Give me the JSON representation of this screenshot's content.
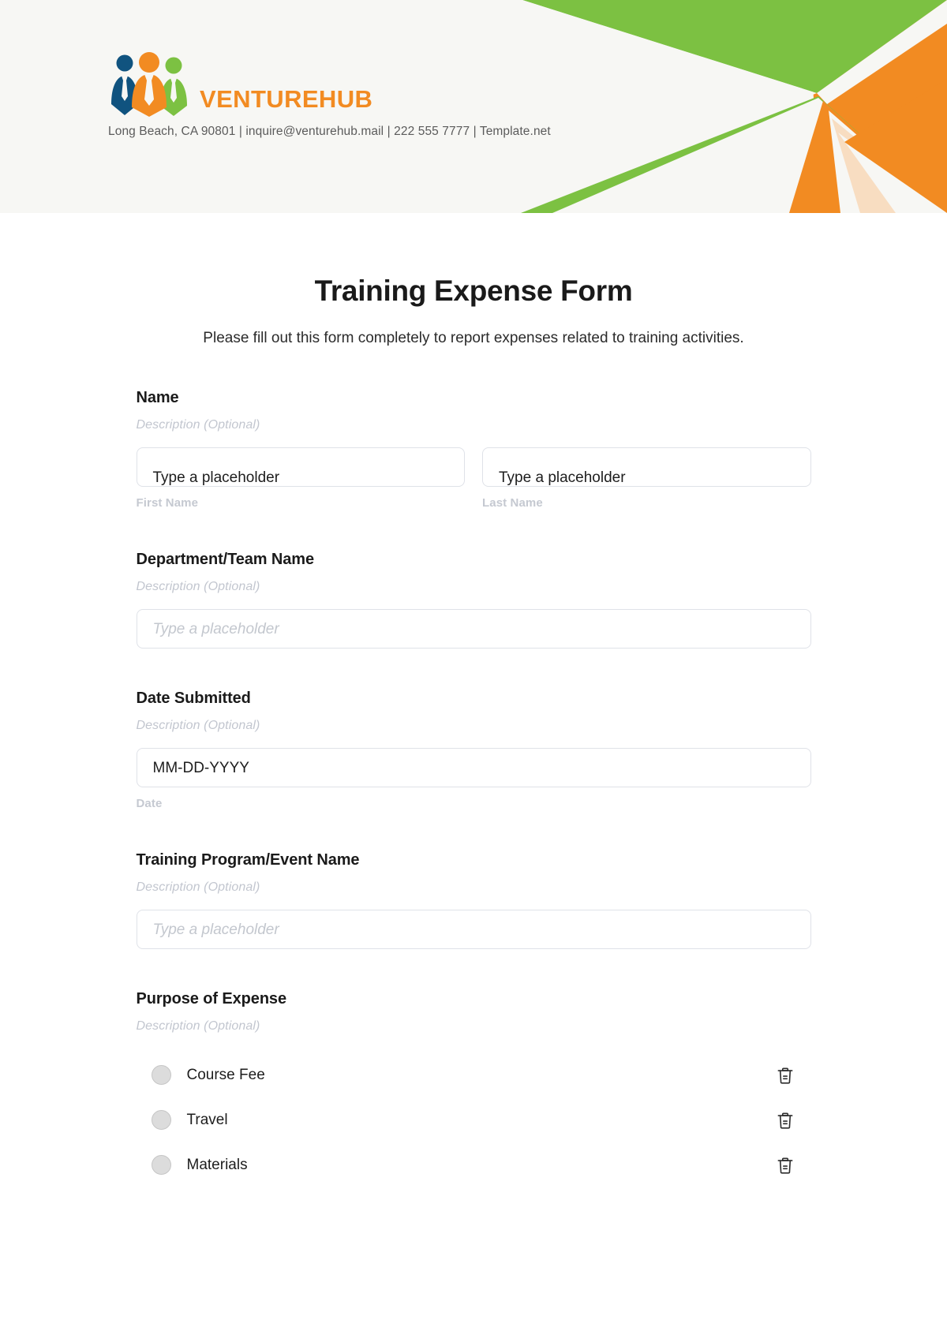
{
  "header": {
    "brand_name": "VENTUREHUB",
    "contact_line": "Long Beach, CA 90801 | inquire@venturehub.mail | 222 555 7777 | Template.net",
    "logo_icon": "three-people-group-icon",
    "colors": {
      "background": "#f7f7f4",
      "brand_orange": "#f28b22",
      "accent_green": "#7cc142",
      "accent_orange": "#f28b22",
      "accent_peach": "#f8ddc1",
      "logo_navy": "#10537f",
      "logo_orange": "#f28b22",
      "logo_green": "#7cc142"
    }
  },
  "form": {
    "title": "Training Expense Form",
    "subtitle": "Please fill out this form completely to report expenses related to training activities.",
    "description_placeholder": "Description (Optional)",
    "sections": [
      {
        "id": "name",
        "label": "Name",
        "description": "Description (Optional)",
        "inputs": [
          {
            "id": "first-name",
            "value": "Type a placeholder",
            "placeholder": "Type a placeholder",
            "sub_label": "First Name",
            "style": "clipped"
          },
          {
            "id": "last-name",
            "value": "Type a placeholder",
            "placeholder": "Type a placeholder",
            "sub_label": "Last Name",
            "style": "clipped"
          }
        ]
      },
      {
        "id": "department-team-name",
        "label": "Department/Team Name",
        "description": "Description (Optional)",
        "inputs": [
          {
            "id": "department",
            "value": "Type a placeholder",
            "placeholder": "Type a placeholder",
            "sub_label": "",
            "style": "placeholder"
          }
        ]
      },
      {
        "id": "date-submitted",
        "label": "Date Submitted",
        "description": "Description (Optional)",
        "inputs": [
          {
            "id": "date",
            "value": "MM-DD-YYYY",
            "placeholder": "MM-DD-YYYY",
            "sub_label": "Date",
            "style": "value"
          }
        ]
      },
      {
        "id": "training-program-event-name",
        "label": "Training Program/Event Name",
        "description": "Description (Optional)",
        "inputs": [
          {
            "id": "training-program",
            "value": "Type a placeholder",
            "placeholder": "Type a placeholder",
            "sub_label": "",
            "style": "placeholder"
          }
        ]
      }
    ],
    "purpose": {
      "label": "Purpose of Expense",
      "description": "Description (Optional)",
      "options": [
        {
          "label": "Course Fee",
          "selected": false,
          "delete_icon": "trash-icon"
        },
        {
          "label": "Travel",
          "selected": false,
          "delete_icon": "trash-icon"
        },
        {
          "label": "Materials",
          "selected": false,
          "delete_icon": "trash-icon"
        }
      ]
    }
  }
}
